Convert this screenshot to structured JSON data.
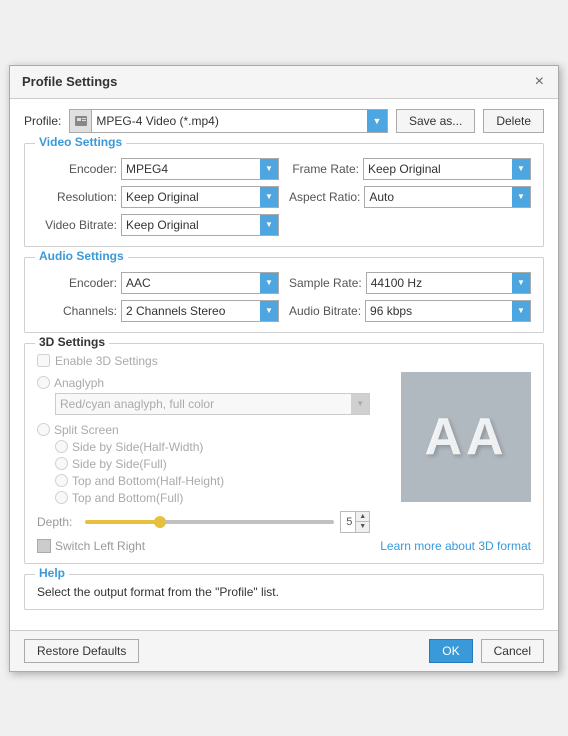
{
  "dialog": {
    "title": "Profile Settings",
    "close_label": "×"
  },
  "profile": {
    "label": "Profile:",
    "value": "MPEG-4 Video (*.mp4)",
    "save_as_label": "Save as...",
    "delete_label": "Delete"
  },
  "video_settings": {
    "title": "Video Settings",
    "encoder_label": "Encoder:",
    "encoder_value": "MPEG4",
    "frame_rate_label": "Frame Rate:",
    "frame_rate_value": "Keep Original",
    "resolution_label": "Resolution:",
    "resolution_value": "Keep Original",
    "aspect_ratio_label": "Aspect Ratio:",
    "aspect_ratio_value": "Auto",
    "video_bitrate_label": "Video Bitrate:",
    "video_bitrate_value": "Keep Original"
  },
  "audio_settings": {
    "title": "Audio Settings",
    "encoder_label": "Encoder:",
    "encoder_value": "AAC",
    "sample_rate_label": "Sample Rate:",
    "sample_rate_value": "44100 Hz",
    "channels_label": "Channels:",
    "channels_value": "2 Channels Stereo",
    "audio_bitrate_label": "Audio Bitrate:",
    "audio_bitrate_value": "96 kbps"
  },
  "settings_3d": {
    "title": "3D Settings",
    "enable_label": "Enable 3D Settings",
    "anaglyph_label": "Anaglyph",
    "anaglyph_option": "Red/cyan anaglyph, full color",
    "split_screen_label": "Split Screen",
    "side_by_side_half_label": "Side by Side(Half-Width)",
    "side_by_side_full_label": "Side by Side(Full)",
    "top_bottom_half_label": "Top and Bottom(Half-Height)",
    "top_bottom_full_label": "Top and Bottom(Full)",
    "depth_label": "Depth:",
    "depth_value": "5",
    "switch_lr_label": "Switch Left Right",
    "learn_more_label": "Learn more about 3D format",
    "preview_letters": "AA"
  },
  "help": {
    "title": "Help",
    "text": "Select the output format from the \"Profile\" list."
  },
  "footer": {
    "restore_defaults_label": "Restore Defaults",
    "ok_label": "OK",
    "cancel_label": "Cancel"
  }
}
